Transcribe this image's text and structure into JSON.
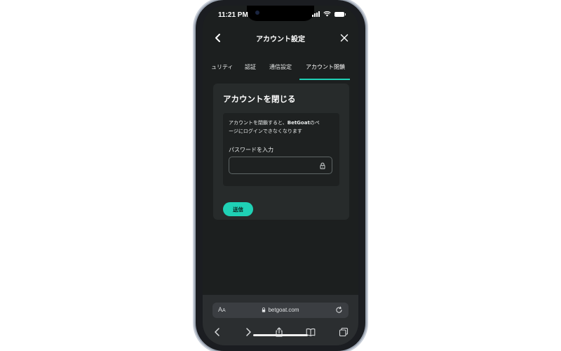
{
  "status": {
    "time": "11:21 PM"
  },
  "header": {
    "title": "アカウント設定"
  },
  "tabs": [
    {
      "label": "ュリティ",
      "active": false
    },
    {
      "label": "認証",
      "active": false
    },
    {
      "label": "通信設定",
      "active": false
    },
    {
      "label": "アカウント閉鎖",
      "active": true
    }
  ],
  "card": {
    "title": "アカウントを閉じる",
    "description_line1": "アカウントを閉鎖すると、",
    "description_brand": "BetGoat",
    "description_line1_end": "のペ",
    "description_line2": "ージにログインできなくなります",
    "password_label": "パスワードを入力",
    "password_value": "",
    "submit_label": "送信"
  },
  "browser": {
    "text_size_label": "A",
    "text_size_label_small": "A",
    "url": "betgoat.com"
  },
  "colors": {
    "accent": "#1fd1b5",
    "background": "#1c1f1f",
    "card": "#272b2b"
  }
}
